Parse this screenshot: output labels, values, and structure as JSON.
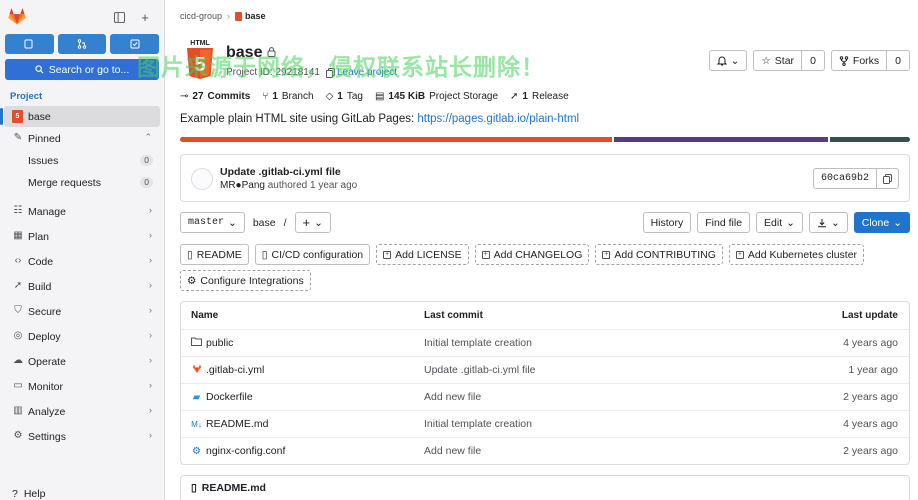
{
  "sidebar": {
    "search_label": "Search or go to...",
    "section_label": "Project",
    "project_name": "base",
    "pinned_label": "Pinned",
    "pinned_items": [
      {
        "label": "Issues",
        "count": "0"
      },
      {
        "label": "Merge requests",
        "count": "0"
      }
    ],
    "nav_items": [
      {
        "label": "Manage",
        "icon": "users-icon"
      },
      {
        "label": "Plan",
        "icon": "plan-icon"
      },
      {
        "label": "Code",
        "icon": "code-icon"
      },
      {
        "label": "Build",
        "icon": "rocket-icon"
      },
      {
        "label": "Secure",
        "icon": "shield-icon"
      },
      {
        "label": "Deploy",
        "icon": "deploy-icon"
      },
      {
        "label": "Operate",
        "icon": "cloud-icon"
      },
      {
        "label": "Monitor",
        "icon": "monitor-icon"
      },
      {
        "label": "Analyze",
        "icon": "chart-icon"
      },
      {
        "label": "Settings",
        "icon": "gear-icon"
      }
    ],
    "help_label": "Help"
  },
  "breadcrumb": {
    "group": "cicd-group",
    "project": "base"
  },
  "project": {
    "title": "base",
    "id_text": "Project ID: 29218141",
    "leave_label": "Leave project",
    "logo_text": "HTML",
    "description": "Example plain HTML site using GitLab Pages:",
    "description_link": "https://pages.gitlab.io/plain-html"
  },
  "header_actions": {
    "star_label": "Star",
    "star_count": "0",
    "forks_label": "Forks",
    "forks_count": "0"
  },
  "stats": [
    {
      "value": "27",
      "label": "Commits",
      "icon": "commit-icon"
    },
    {
      "value": "1",
      "label": "Branch",
      "icon": "branch-icon"
    },
    {
      "value": "1",
      "label": "Tag",
      "icon": "tag-icon"
    },
    {
      "value": "145 KiB",
      "label": "Project Storage",
      "icon": "storage-icon"
    },
    {
      "value": "1",
      "label": "Release",
      "icon": "rocket-icon"
    }
  ],
  "language_bar": [
    {
      "color": "#e34c26",
      "share": 0.595
    },
    {
      "color": "#563d7c",
      "share": 0.295
    },
    {
      "color": "#384d54",
      "share": 0.11
    }
  ],
  "last_commit": {
    "title": "Update .gitlab-ci.yml file",
    "author": "MR●Pang",
    "meta": "authored 1 year ago",
    "sha": "60ca69b2"
  },
  "repo_toolbar": {
    "branch": "master",
    "path": "base",
    "path_sep": "/",
    "history_label": "History",
    "find_file_label": "Find file",
    "edit_label": "Edit",
    "clone_label": "Clone"
  },
  "shortcuts": [
    {
      "label": "README",
      "icon": "file-icon",
      "dashed": false
    },
    {
      "label": "CI/CD configuration",
      "icon": "file-icon",
      "dashed": false
    },
    {
      "label": "Add LICENSE",
      "icon": "plus-square-icon",
      "dashed": true
    },
    {
      "label": "Add CHANGELOG",
      "icon": "plus-square-icon",
      "dashed": true
    },
    {
      "label": "Add CONTRIBUTING",
      "icon": "plus-square-icon",
      "dashed": true
    },
    {
      "label": "Add Kubernetes cluster",
      "icon": "plus-square-icon",
      "dashed": true
    },
    {
      "label": "Configure Integrations",
      "icon": "gear-icon",
      "dashed": true
    }
  ],
  "files": {
    "headers": {
      "name": "Name",
      "commit": "Last commit",
      "date": "Last update"
    },
    "rows": [
      {
        "name": "public",
        "icon": "folder-icon",
        "commit": "Initial template creation",
        "date": "4 years ago"
      },
      {
        "name": ".gitlab-ci.yml",
        "icon": "gitlab-icon",
        "commit": "Update .gitlab-ci.yml file",
        "date": "1 year ago"
      },
      {
        "name": "Dockerfile",
        "icon": "docker-icon",
        "commit": "Add new file",
        "date": "2 years ago"
      },
      {
        "name": "README.md",
        "icon": "markdown-icon",
        "commit": "Initial template creation",
        "date": "4 years ago"
      },
      {
        "name": "nginx-config.conf",
        "icon": "config-icon",
        "commit": "Add new file",
        "date": "2 years ago"
      }
    ]
  },
  "readme_title": "README.md",
  "watermark": "图片来源于网络，侵权联系站长删除！"
}
